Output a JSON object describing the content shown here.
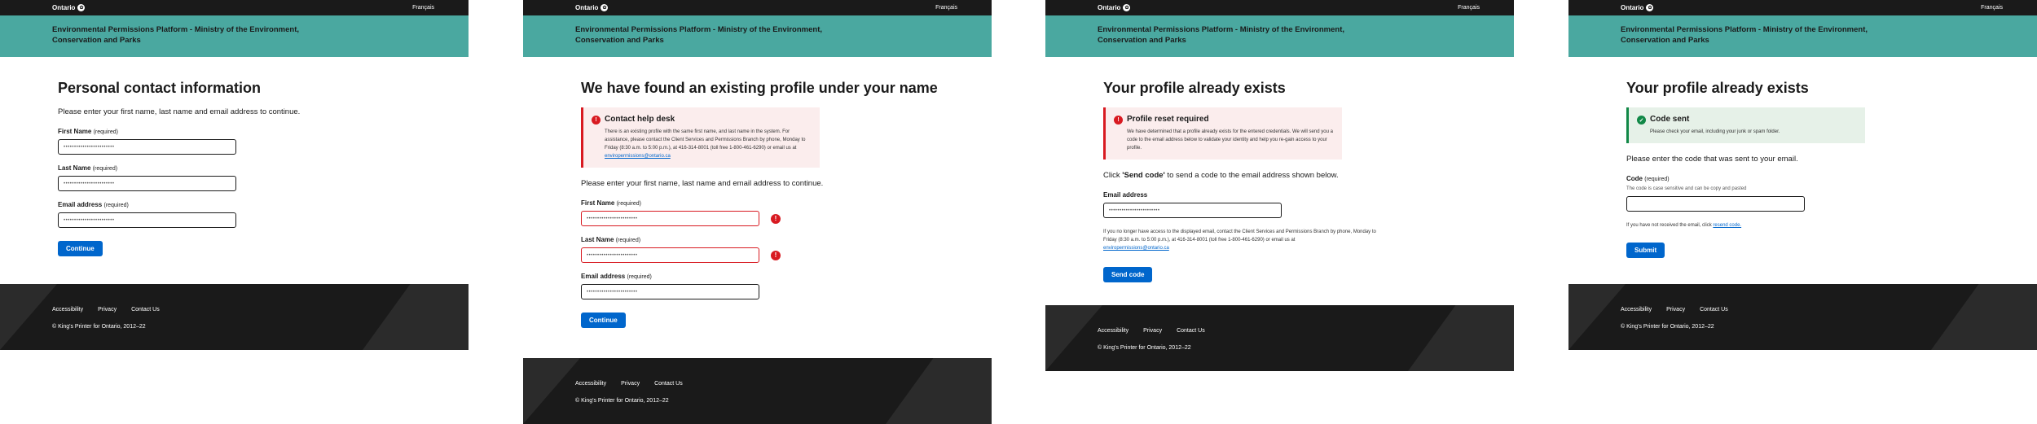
{
  "header": {
    "brand": "Ontario",
    "language_link": "Français",
    "app_title": "Environmental Permissions Platform - Ministry of the Environment, Conservation and Parks"
  },
  "footer": {
    "links": [
      "Accessibility",
      "Privacy",
      "Contact Us"
    ],
    "copyright": "© King's Printer for Ontario, 2012–22"
  },
  "masked_value": "••••••••••••••••••••••••",
  "required_text": "(required)",
  "screen1": {
    "title": "Personal contact information",
    "intro": "Please enter your first name, last name and email address to continue.",
    "fields": [
      {
        "label": "First Name"
      },
      {
        "label": "Last Name"
      },
      {
        "label": "Email address"
      }
    ],
    "button": "Continue"
  },
  "screen2": {
    "title": "We have found an existing profile under your name",
    "alert_title": "Contact help desk",
    "alert_body": "There is an existing profile with the same first name, and last name in the system. For assistance, please contact the Client Services and Permissions Branch by phone, Monday to Friday (8:30 a.m. to 5:00 p.m.), at 416-314-8001 (toll free 1-800-461-6290) or email us at",
    "alert_email": "enviropermissions@ontario.ca",
    "intro": "Please enter your first name, last name and email address to continue.",
    "fields": [
      {
        "label": "First Name"
      },
      {
        "label": "Last Name"
      },
      {
        "label": "Email address"
      }
    ],
    "button": "Continue"
  },
  "screen3": {
    "title": "Your profile already exists",
    "alert_title": "Profile reset required",
    "alert_body": "We have determined that a profile already exists for the entered credentials. We will send you a code to the email address below to validate your identity and help you re-gain access to your profile.",
    "instruction_pre": "Click ",
    "instruction_bold": "'Send code'",
    "instruction_post": " to send a code to the email address shown below.",
    "email_label": "Email address",
    "help_text": "If you no longer have access to the displayed email, contact the Client Services and Permissions Branch by phone, Monday to Friday (8:30 a.m. to 5:00 p.m.), at 416-314-8001 (toll free 1-800-461-6290) or email us at",
    "help_email": "enviropermissions@ontario.ca",
    "button": "Send code"
  },
  "screen4": {
    "title": "Your profile already exists",
    "alert_title": "Code sent",
    "alert_body": "Please check your email, including your junk or spam folder.",
    "intro": "Please enter the code that was sent to your email.",
    "code_label": "Code",
    "code_hint": "The code is case sensitive and can be copy and pasted",
    "resend_pre": "If you have not received the email, click ",
    "resend_link": "resend code.",
    "button": "Submit"
  }
}
